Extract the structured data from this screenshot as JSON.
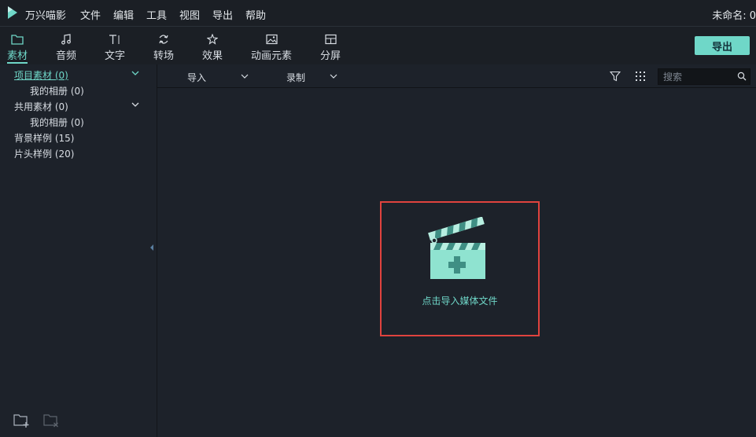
{
  "menubar": {
    "app_name": "万兴喵影",
    "items": [
      "文件",
      "编辑",
      "工具",
      "视图",
      "导出",
      "帮助"
    ],
    "doc_title": "未命名: 0"
  },
  "toolbar": {
    "tabs": [
      {
        "label": "素材",
        "icon": "folder-icon",
        "active": true
      },
      {
        "label": "音频",
        "icon": "music-note-icon"
      },
      {
        "label": "文字",
        "icon": "text-icon"
      },
      {
        "label": "转场",
        "icon": "transition-icon"
      },
      {
        "label": "效果",
        "icon": "effects-icon"
      },
      {
        "label": "动画元素",
        "icon": "image-icon"
      },
      {
        "label": "分屏",
        "icon": "split-screen-icon"
      }
    ],
    "export_label": "导出"
  },
  "sidebar": {
    "items": [
      {
        "label": "项目素材 (0)",
        "selected": true
      },
      {
        "label": "我的相册 (0)"
      },
      {
        "label": "共用素材 (0)"
      },
      {
        "label": "我的相册 (0)"
      },
      {
        "label": "背景样例 (15)"
      },
      {
        "label": "片头样例 (20)"
      }
    ]
  },
  "media": {
    "import_label": "导入",
    "record_label": "录制",
    "search_placeholder": "搜索",
    "import_hint": "点击导入媒体文件"
  },
  "colors": {
    "accent": "#6fd7c8",
    "highlight_border": "#e0433e",
    "background": "#1d222a"
  }
}
